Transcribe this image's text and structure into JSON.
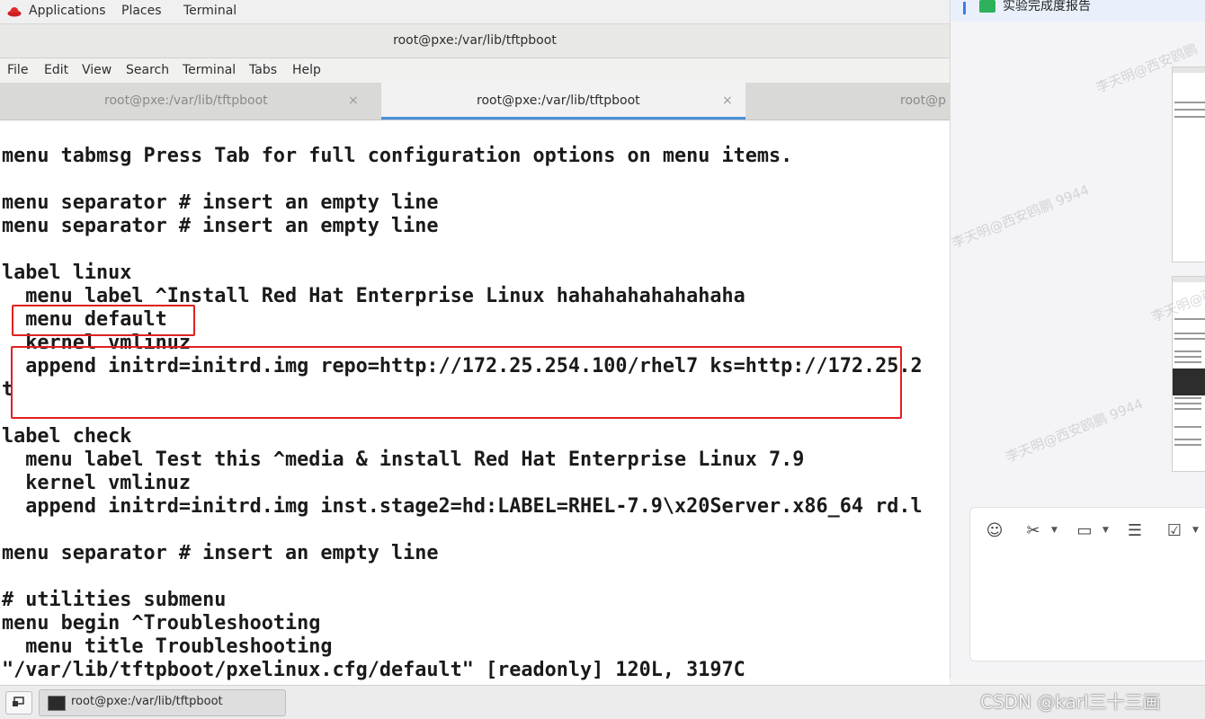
{
  "topbar": {
    "applications": "Applications",
    "places": "Places",
    "terminal": "Terminal"
  },
  "window": {
    "title": "root@pxe:/var/lib/tftpboot",
    "menu": [
      "File",
      "Edit",
      "View",
      "Search",
      "Terminal",
      "Tabs",
      "Help"
    ],
    "tabs": [
      {
        "label": "root@pxe:/var/lib/tftpboot",
        "close": "×",
        "active": false
      },
      {
        "label": "root@pxe:/var/lib/tftpboot",
        "close": "×",
        "active": true
      },
      {
        "label": "root@p",
        "close": "",
        "active": false
      }
    ]
  },
  "terminal": {
    "lines": [
      "menu tabmsg Press Tab for full configuration options on menu items.",
      "",
      "menu separator # insert an empty line",
      "menu separator # insert an empty line",
      "",
      "label linux",
      "  menu label ^Install Red Hat Enterprise Linux hahahahahahahaha",
      "  menu default",
      "  kernel vmlinuz",
      "  append initrd=initrd.img repo=http://172.25.254.100/rhel7 ks=http://172.25.2",
      "t",
      "",
      "label check",
      "  menu label Test this ^media & install Red Hat Enterprise Linux 7.9",
      "  kernel vmlinuz",
      "  append initrd=initrd.img inst.stage2=hd:LABEL=RHEL-7.9\\x20Server.x86_64 rd.l",
      "",
      "menu separator # insert an empty line",
      "",
      "# utilities submenu",
      "menu begin ^Troubleshooting",
      "  menu title Troubleshooting",
      "\"/var/lib/tftpboot/pxelinux.cfg/default\" [readonly] 120L, 3197C"
    ]
  },
  "side_panel": {
    "header_text": "实验完成度报告",
    "watermarks": [
      "李天明@西安鸥鹏 9944",
      "李天明@西安鸥鹏 9944",
      "李天明@西安鸥鹏 9944",
      "李天明@西安鸥鹏"
    ]
  },
  "taskbar": {
    "task_label": "root@pxe:/var/lib/tftpboot"
  },
  "overlay": {
    "csdn_watermark": "CSDN @karl三十三画"
  }
}
